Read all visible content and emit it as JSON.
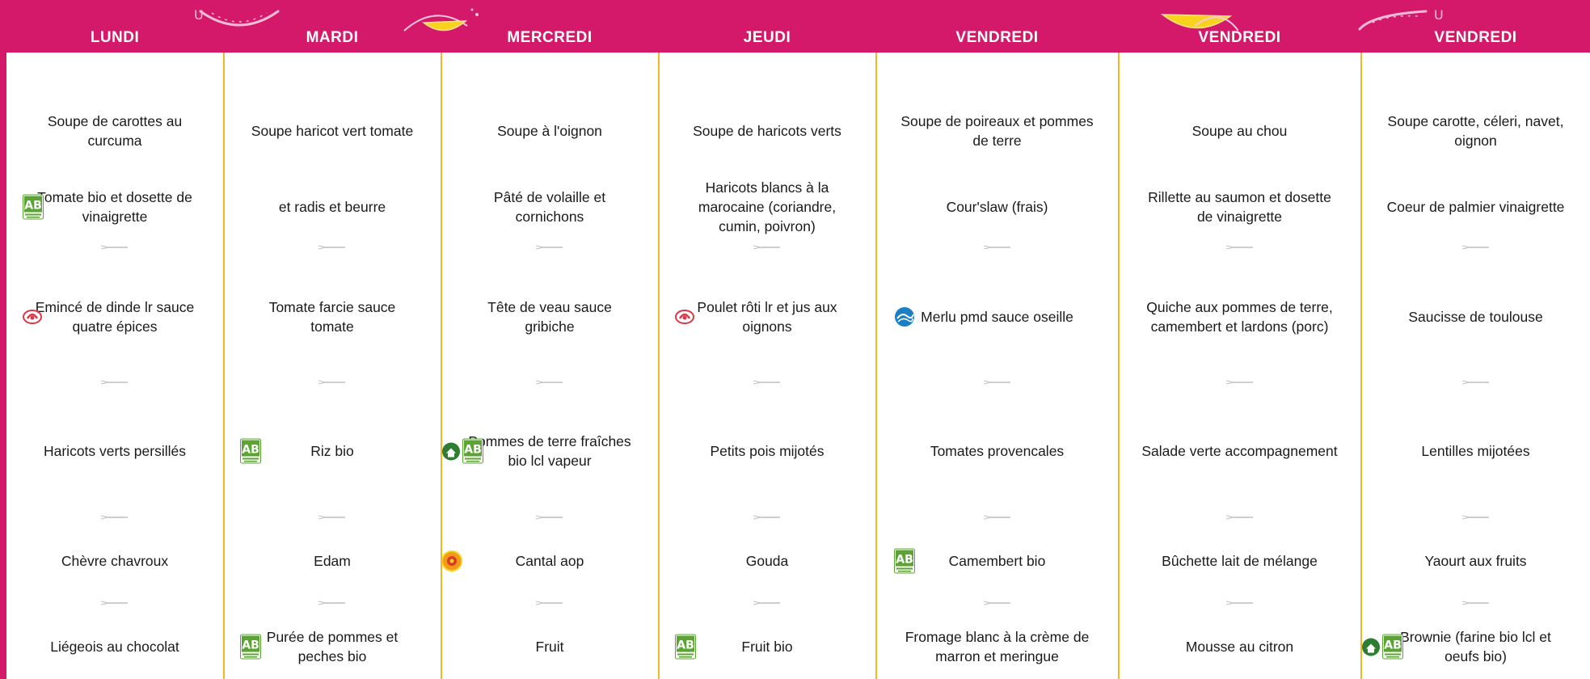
{
  "colors": {
    "header": "#d4196a",
    "divider": "#f2b822",
    "text": "#1a1a1a",
    "bio_green": "#5aa532",
    "label_rouge": "#d93a4a",
    "peche_blue": "#1b7fc4",
    "aop_orange": "#f29a1a"
  },
  "days": [
    {
      "label": "LUNDI",
      "dishes": [
        {
          "text": "Soupe de carottes au curcuma",
          "badges": []
        },
        {
          "text": "Tomate bio et dosette de vinaigrette",
          "badges": [
            "ab-bio-icon"
          ]
        },
        {
          "text": "Emincé de dinde lr sauce quatre épices",
          "badges": [
            "label-rouge-icon"
          ]
        },
        {
          "text": "Haricots verts persillés",
          "badges": []
        },
        {
          "text": "Chèvre chavroux",
          "badges": []
        },
        {
          "text": "Liégeois au chocolat",
          "badges": []
        }
      ]
    },
    {
      "label": "MARDI",
      "dishes": [
        {
          "text": "Soupe haricot vert tomate",
          "badges": []
        },
        {
          "text": "et radis et beurre",
          "badges": []
        },
        {
          "text": "Tomate farcie sauce tomate",
          "badges": []
        },
        {
          "text": "Riz bio",
          "badges": [
            "ab-bio-icon"
          ]
        },
        {
          "text": "Edam",
          "badges": []
        },
        {
          "text": "Purée de pommes et peches bio",
          "badges": [
            "ab-bio-icon"
          ]
        }
      ]
    },
    {
      "label": "MERCREDI",
      "dishes": [
        {
          "text": "Soupe à l'oignon",
          "badges": []
        },
        {
          "text": "Pâté de volaille et cornichons",
          "badges": []
        },
        {
          "text": "Tête de veau sauce gribiche",
          "badges": []
        },
        {
          "text": "Pommes de terre fraîches bio lcl vapeur",
          "badges": [
            "local-farm-icon",
            "ab-bio-icon"
          ]
        },
        {
          "text": "Cantal aop",
          "badges": [
            "aop-icon"
          ]
        },
        {
          "text": "Fruit",
          "badges": []
        }
      ]
    },
    {
      "label": "JEUDI",
      "dishes": [
        {
          "text": "Soupe de haricots verts",
          "badges": []
        },
        {
          "text": "Haricots blancs à la marocaine (coriandre, cumin, poivron)",
          "badges": []
        },
        {
          "text": "Poulet rôti lr et jus aux oignons",
          "badges": [
            "label-rouge-icon"
          ]
        },
        {
          "text": "Petits pois mijotés",
          "badges": []
        },
        {
          "text": "Gouda",
          "badges": []
        },
        {
          "text": "Fruit bio",
          "badges": [
            "ab-bio-icon"
          ]
        }
      ]
    },
    {
      "label": "VENDREDI",
      "dishes": [
        {
          "text": "Soupe de poireaux et pommes de terre",
          "badges": []
        },
        {
          "text": "Cour'slaw (frais)",
          "badges": []
        },
        {
          "text": "Merlu pmd sauce oseille",
          "badges": [
            "peche-durable-icon"
          ]
        },
        {
          "text": "Tomates provencales",
          "badges": []
        },
        {
          "text": "Camembert bio",
          "badges": [
            "ab-bio-icon"
          ]
        },
        {
          "text": "Fromage blanc à la crème de marron et meringue",
          "badges": []
        }
      ]
    },
    {
      "label": "VENDREDI",
      "dishes": [
        {
          "text": "Soupe au chou",
          "badges": []
        },
        {
          "text": "Rillette au saumon et dosette de vinaigrette",
          "badges": []
        },
        {
          "text": "Quiche aux pommes de terre, camembert et lardons (porc)",
          "badges": []
        },
        {
          "text": "Salade verte accompagnement",
          "badges": []
        },
        {
          "text": "Bûchette lait de mélange",
          "badges": []
        },
        {
          "text": "Mousse au citron",
          "badges": []
        }
      ]
    },
    {
      "label": "VENDREDI",
      "dishes": [
        {
          "text": "Soupe carotte, céleri, navet, oignon",
          "badges": []
        },
        {
          "text": "Coeur de palmier vinaigrette",
          "badges": []
        },
        {
          "text": "Saucisse de toulouse",
          "badges": []
        },
        {
          "text": "Lentilles mijotées",
          "badges": []
        },
        {
          "text": "Yaourt aux fruits",
          "badges": []
        },
        {
          "text": "Brownie (farine bio lcl et oeufs bio)",
          "badges": [
            "local-farm-icon",
            "ab-bio-icon"
          ]
        }
      ]
    }
  ]
}
